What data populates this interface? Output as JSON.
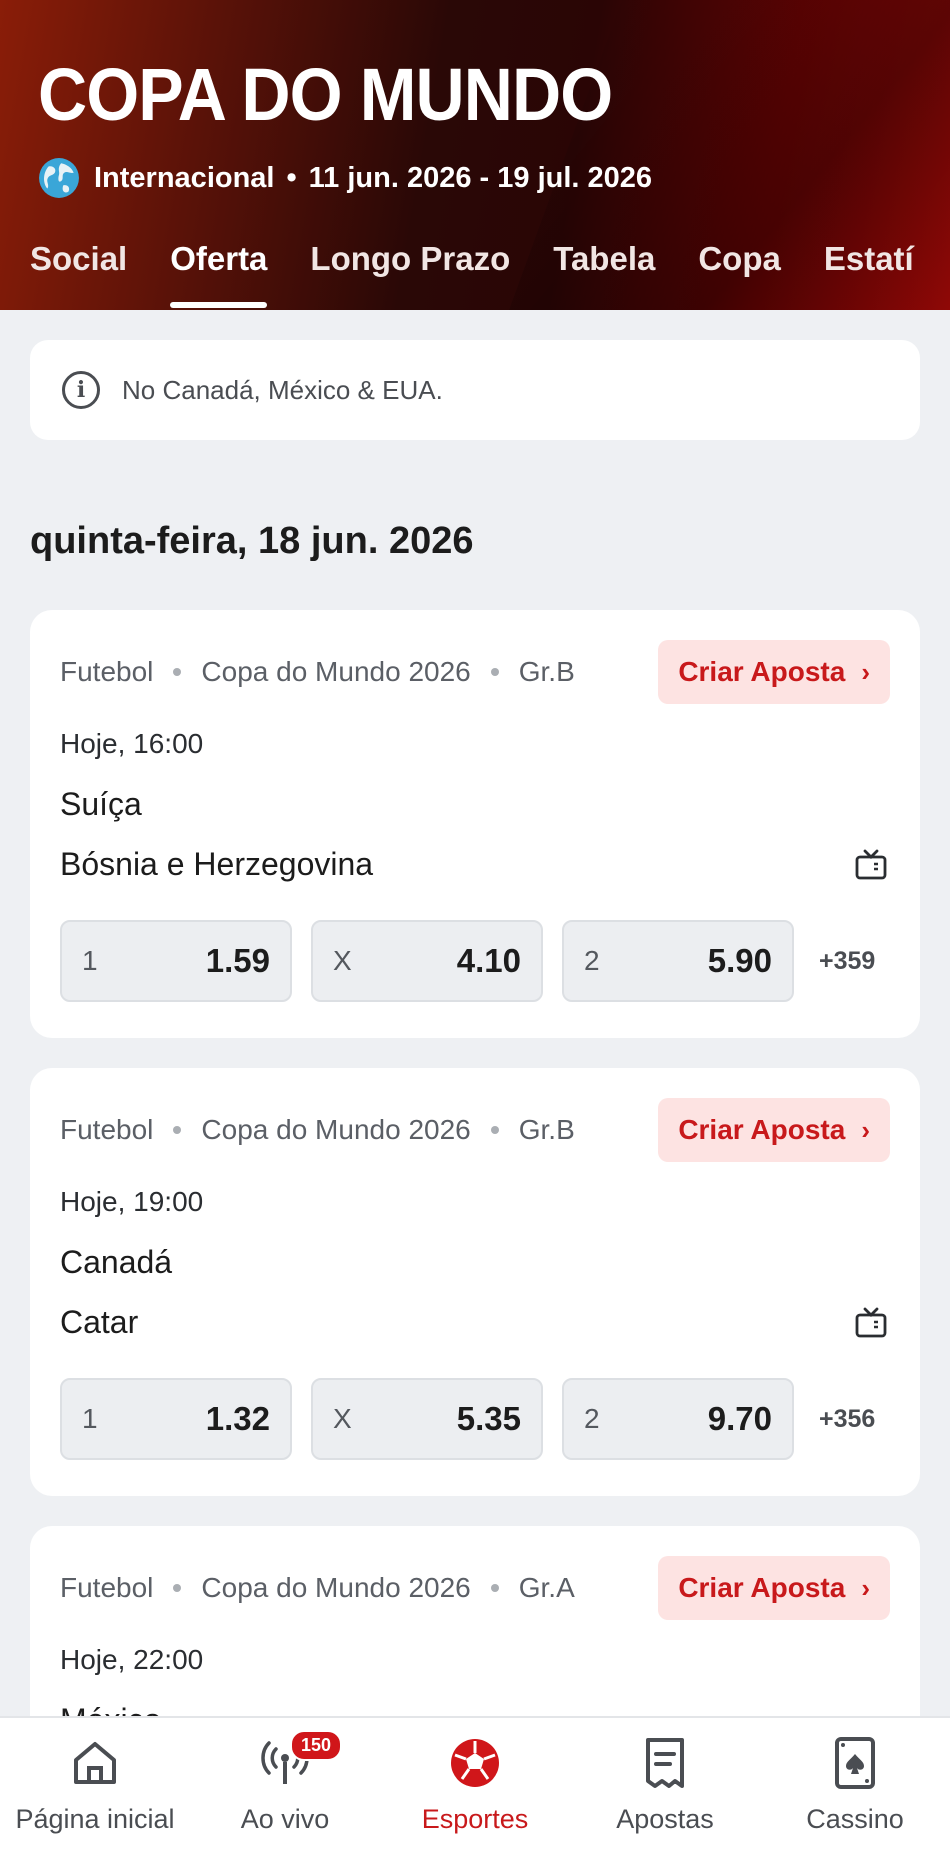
{
  "header": {
    "title": "COPA DO MUNDO",
    "region": "Internacional",
    "dates": "11 jun. 2026 - 19 jul. 2026",
    "tabs": [
      "Social",
      "Oferta",
      "Longo Prazo",
      "Tabela",
      "Copa",
      "Estatí"
    ]
  },
  "info": {
    "text": "No Canadá, México & EUA."
  },
  "date_heading": "quinta-feira, 18 jun. 2026",
  "events": [
    {
      "sport": "Futebol",
      "competition": "Copa do Mundo 2026",
      "group": "Gr.B",
      "criar_label": "Criar Aposta",
      "time": "Hoje, 16:00",
      "team1": "Suíça",
      "team2": "Bósnia e Herzegovina",
      "odds": [
        {
          "label": "1",
          "value": "1.59"
        },
        {
          "label": "X",
          "value": "4.10"
        },
        {
          "label": "2",
          "value": "5.90"
        }
      ],
      "more": "+359"
    },
    {
      "sport": "Futebol",
      "competition": "Copa do Mundo 2026",
      "group": "Gr.B",
      "criar_label": "Criar Aposta",
      "time": "Hoje, 19:00",
      "team1": "Canadá",
      "team2": "Catar",
      "odds": [
        {
          "label": "1",
          "value": "1.32"
        },
        {
          "label": "X",
          "value": "5.35"
        },
        {
          "label": "2",
          "value": "9.70"
        }
      ],
      "more": "+356"
    },
    {
      "sport": "Futebol",
      "competition": "Copa do Mundo 2026",
      "group": "Gr.A",
      "criar_label": "Criar Aposta",
      "time": "Hoje, 22:00",
      "team1": "México"
    }
  ],
  "bottom_nav": [
    {
      "label": "Página inicial",
      "icon": "home-icon"
    },
    {
      "label": "Ao vivo",
      "icon": "live-icon",
      "badge": "150"
    },
    {
      "label": "Esportes",
      "icon": "soccer-ball-icon",
      "active": true
    },
    {
      "label": "Apostas",
      "icon": "bet-slip-icon"
    },
    {
      "label": "Cassino",
      "icon": "casino-card-icon"
    }
  ],
  "colors": {
    "accent": "#c8191b",
    "header_dark": "#2a0806",
    "header_red": "#9a0a08",
    "page_bg": "#eef0f3"
  }
}
